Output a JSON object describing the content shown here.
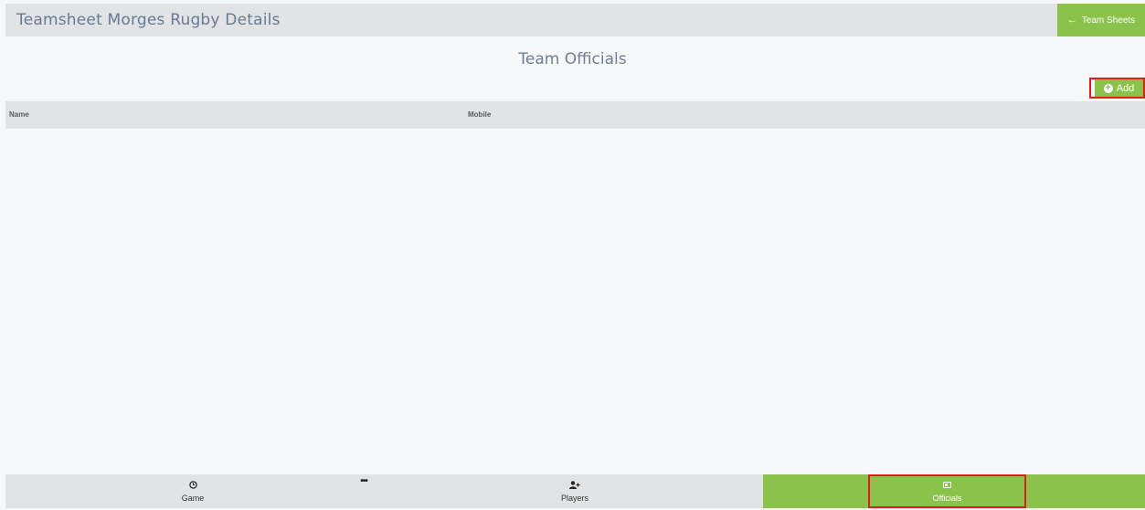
{
  "header": {
    "title": "Teamsheet Morges Rugby Details",
    "back_button": {
      "icon": "arrow-left-icon",
      "label": "Team Sheets"
    }
  },
  "section": {
    "title": "Team Officials",
    "add_button": {
      "icon": "plus-circle-icon",
      "label": "Add"
    }
  },
  "table": {
    "columns": [
      "Name",
      "Mobile"
    ],
    "rows": []
  },
  "bottom_nav": {
    "items": [
      {
        "icon": "clock-icon",
        "label": "Game"
      },
      {
        "icon": "more-dots-icon",
        "label": ""
      },
      {
        "icon": "user-plus-icon",
        "label": "Players"
      },
      {
        "icon": "id-card-icon",
        "label": "Officials",
        "active": true
      }
    ]
  },
  "colors": {
    "accent": "#8bc34a",
    "header_bg": "#e1e3e5",
    "highlight": "#e21b1b"
  }
}
